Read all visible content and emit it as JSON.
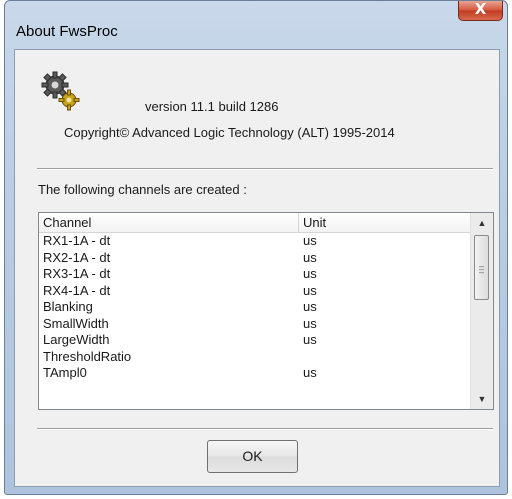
{
  "window": {
    "title": "About FwsProc",
    "close_glyph": "X"
  },
  "about": {
    "icon": "gears-icon",
    "version": "version 11.1 build 1286",
    "copyright": "Copyright© Advanced Logic Technology (ALT) 1995-2014",
    "channels_label": "The following channels are created :"
  },
  "table": {
    "headers": [
      "Channel",
      "Unit"
    ],
    "rows": [
      {
        "channel": "RX1-1A - dt",
        "unit": "us"
      },
      {
        "channel": "RX2-1A - dt",
        "unit": "us"
      },
      {
        "channel": "RX3-1A - dt",
        "unit": "us"
      },
      {
        "channel": "RX4-1A - dt",
        "unit": "us"
      },
      {
        "channel": "Blanking",
        "unit": "us"
      },
      {
        "channel": "SmallWidth",
        "unit": "us"
      },
      {
        "channel": "LargeWidth",
        "unit": "us"
      },
      {
        "channel": "ThresholdRatio",
        "unit": ""
      },
      {
        "channel": "TAmpl0",
        "unit": "us"
      }
    ]
  },
  "buttons": {
    "ok_label": "OK"
  },
  "colors": {
    "frame": "#b9cde4",
    "close_button": "#c13a1f",
    "client_bg": "#f0f0f0"
  }
}
